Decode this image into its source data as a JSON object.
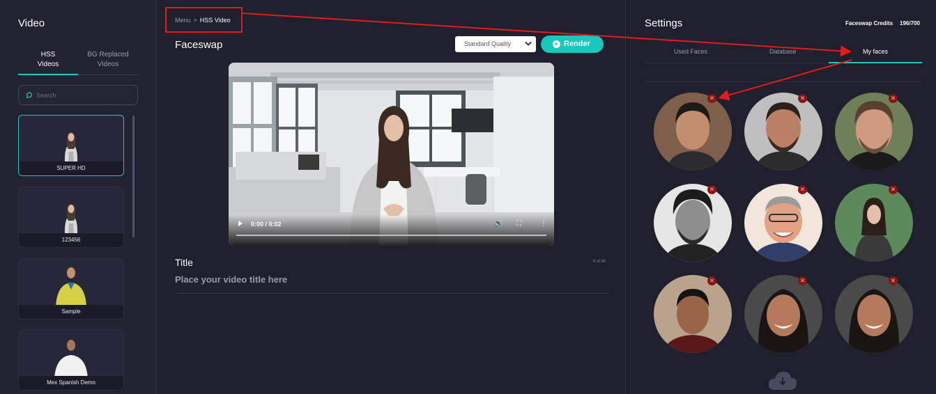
{
  "left": {
    "title": "Video",
    "tabs": [
      {
        "line1": "HSS",
        "line2": "Videos",
        "active": true
      },
      {
        "line1": "BG Replaced",
        "line2": "Videos",
        "active": false
      }
    ],
    "search_placeholder": "Search",
    "videos": [
      {
        "label": "SUPER HD",
        "selected": true
      },
      {
        "label": "123456",
        "selected": false
      },
      {
        "label": "Sample",
        "selected": false
      },
      {
        "label": "Mex Spanish Demo",
        "selected": false
      }
    ]
  },
  "center": {
    "breadcrumb": {
      "menu": "Menu",
      "separator": ">",
      "current": "HSS Video"
    },
    "title": "Faceswap",
    "quality_selected": "Standard Quality",
    "render_label": "Render",
    "video": {
      "time": "0:00 / 0:02",
      "progress": 0
    },
    "title_label": "Title",
    "title_count": "0 of 40",
    "title_placeholder": "Place your video title here"
  },
  "right": {
    "title": "Settings",
    "credits_label": "Faceswap Credits",
    "credits_value": "196/700",
    "tabs": [
      "Used Faces",
      "Database",
      "My faces"
    ],
    "active_tab": "My faces",
    "face_count": 9
  },
  "colors": {
    "accent": "#1fc9c2",
    "render": "#18c8bd",
    "annotation": "#e21b1b",
    "delete": "#8a1414"
  }
}
